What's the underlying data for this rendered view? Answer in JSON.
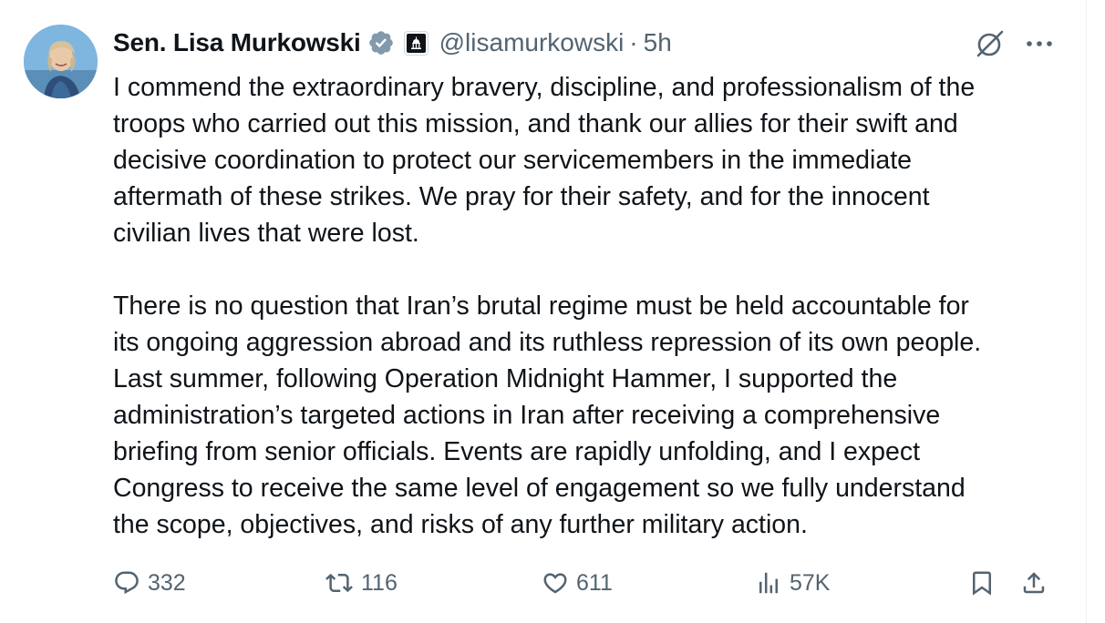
{
  "tweet": {
    "author_name": "Sen. Lisa Murkowski",
    "handle": "@lisamurkowski",
    "separator": "·",
    "time": "5h",
    "icons": {
      "avatar": "profile-photo",
      "verified": "verified-badge-icon",
      "affiliation": "capitol-building-icon",
      "grok": "grok-icon",
      "more": "more-dots-icon"
    },
    "paragraphs": [
      "I commend the extraordinary bravery, discipline, and professionalism of the\ntroops who carried out this mission, and thank our allies for their swift and\ndecisive coordination to protect our servicemembers in the immediate\naftermath of these strikes. We pray for their safety, and for the innocent\ncivilian lives that were lost.",
      "There is no question that Iran’s brutal regime must be held accountable for\nits ongoing aggression abroad and its ruthless repression of its own people.\nLast summer, following Operation Midnight Hammer, I supported the\nadministration’s targeted actions in Iran after receiving a comprehensive\nbriefing from senior officials. Events are rapidly unfolding, and I expect\nCongress to receive the same level of engagement so we fully understand\nthe scope, objectives, and risks of any further military action."
    ],
    "actions": {
      "replies": "332",
      "reposts": "116",
      "likes": "611",
      "views": "57K"
    }
  },
  "colors": {
    "text": "#0f1419",
    "secondary": "#536471",
    "verified_badge": "#829aab",
    "border": "#eff3f4"
  }
}
